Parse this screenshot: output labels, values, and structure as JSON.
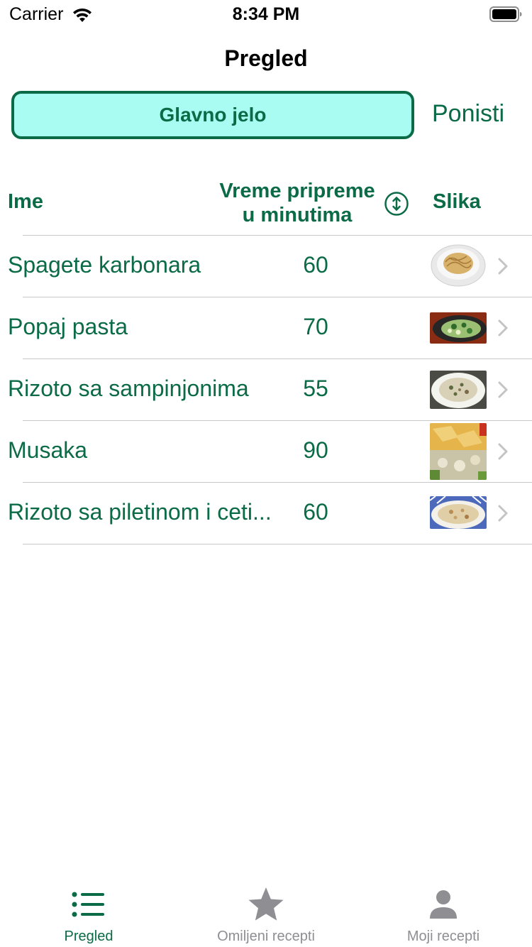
{
  "status": {
    "carrier": "Carrier",
    "time": "8:34 PM"
  },
  "nav": {
    "title": "Pregled"
  },
  "filter": {
    "selected": "Glavno jelo",
    "reset_label": "Ponisti"
  },
  "table": {
    "headers": {
      "name": "Ime",
      "time_line1": "Vreme pripreme",
      "time_line2": "u minutima",
      "image": "Slika"
    },
    "rows": [
      {
        "name": "Spagete karbonara",
        "minutes": "60",
        "image": "spaghetti-carbonara-photo"
      },
      {
        "name": "Popaj pasta",
        "minutes": "70",
        "image": "popaj-pasta-photo"
      },
      {
        "name": "Rizoto sa sampinjonima",
        "minutes": "55",
        "image": "mushroom-risotto-photo"
      },
      {
        "name": "Musaka",
        "minutes": "90",
        "image": "moussaka-photo"
      },
      {
        "name": "Rizoto sa piletinom i ceti...",
        "minutes": "60",
        "image": "chicken-risotto-photo"
      }
    ]
  },
  "tabs": [
    {
      "label": "Pregled",
      "icon": "list-icon",
      "active": true
    },
    {
      "label": "Omiljeni recepti",
      "icon": "star-icon",
      "active": false
    },
    {
      "label": "Moji recepti",
      "icon": "person-icon",
      "active": false
    }
  ],
  "colors": {
    "accent": "#0b6b47",
    "filter_bg": "#a8fcf2",
    "inactive_tab": "#8e8e93"
  }
}
